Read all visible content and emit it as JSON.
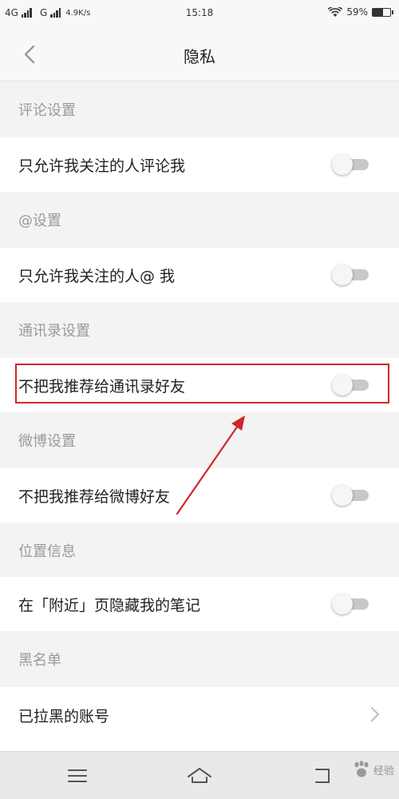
{
  "status_bar": {
    "network1": "4G",
    "network2": "G",
    "speed": "4.9K/s",
    "time": "15:18",
    "battery_text": "59%",
    "battery_level": 0.59,
    "icons": [
      "signal-icon",
      "wifi-icon",
      "battery-icon"
    ]
  },
  "header": {
    "title": "隐私",
    "back_icon": "chevron-left-icon"
  },
  "sections": [
    {
      "title": "评论设置",
      "row": {
        "label": "只允许我关注的人评论我",
        "control": "toggle",
        "on": false
      }
    },
    {
      "title": "@设置",
      "row": {
        "label": "只允许我关注的人@ 我",
        "control": "toggle",
        "on": false
      }
    },
    {
      "title": "通讯录设置",
      "row": {
        "label": "不把我推荐给通讯录好友",
        "control": "toggle",
        "on": false
      }
    },
    {
      "title": "微博设置",
      "row": {
        "label": "不把我推荐给微博好友",
        "control": "toggle",
        "on": false
      }
    },
    {
      "title": "位置信息",
      "row": {
        "label": "在「附近」页隐藏我的笔记",
        "control": "toggle",
        "on": false
      }
    },
    {
      "title": "黑名单",
      "row": {
        "label": "已拉黑的账号",
        "control": "chevron"
      }
    }
  ],
  "annotation": {
    "highlight_color": "#d0262a",
    "arrow_color": "#d0262a"
  },
  "nav_bar": {
    "icons": [
      "menu-icon",
      "home-icon",
      "back-icon"
    ]
  },
  "watermark": {
    "text": "经验",
    "logo": "Bai 百度"
  }
}
